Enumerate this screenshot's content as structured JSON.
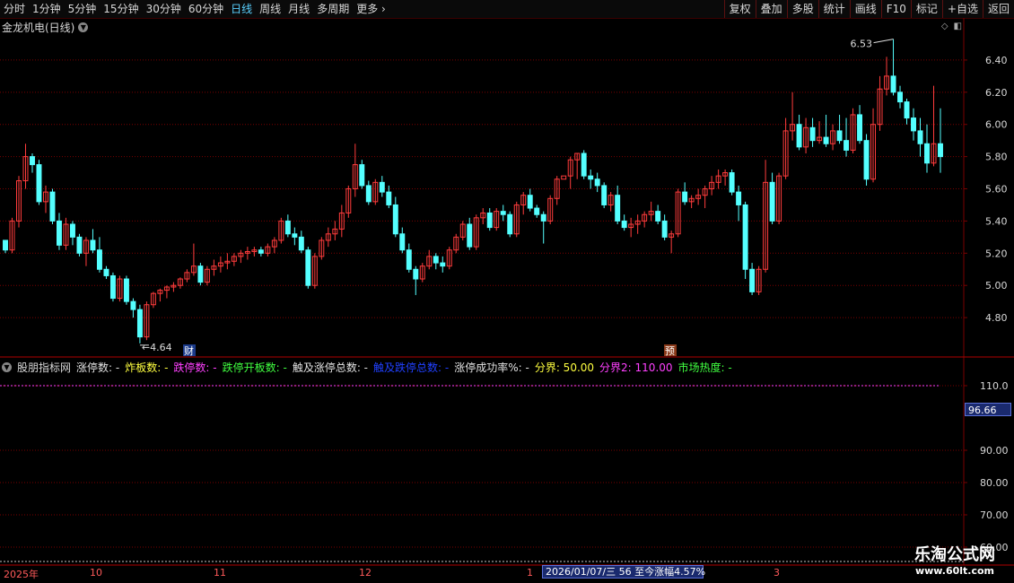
{
  "toolbar": {
    "periods": [
      "分时",
      "1分钟",
      "5分钟",
      "15分钟",
      "30分钟",
      "60分钟",
      "日线",
      "周线",
      "月线",
      "多周期",
      "更多"
    ],
    "active_period": "日线",
    "more_icon": "chevron-right-icon",
    "buttons": [
      "复权",
      "叠加",
      "多股",
      "统计",
      "画线",
      "F10",
      "标记",
      "+自选",
      "返回"
    ]
  },
  "chart": {
    "title": "金龙机电(日线)",
    "title_icon": "chevron-down-icon",
    "price_axis": [
      "6.40",
      "6.20",
      "6.00",
      "5.80",
      "5.60",
      "5.40",
      "5.20",
      "5.00",
      "4.80"
    ],
    "high_label": "6.53",
    "low_label": "4.64",
    "marker_cai": "财",
    "marker_yu": "预",
    "colors": {
      "up": "#ff3c3c",
      "down": "#54ffff",
      "grid": "#7a0000"
    }
  },
  "chart_data": {
    "type": "candlestick",
    "ohlc": [
      [
        5.28,
        5.28,
        5.2,
        5.22
      ],
      [
        5.22,
        5.42,
        5.2,
        5.4
      ],
      [
        5.4,
        5.68,
        5.36,
        5.65
      ],
      [
        5.65,
        5.88,
        5.6,
        5.8
      ],
      [
        5.8,
        5.82,
        5.7,
        5.75
      ],
      [
        5.75,
        5.78,
        5.5,
        5.52
      ],
      [
        5.52,
        5.62,
        5.45,
        5.58
      ],
      [
        5.58,
        5.6,
        5.38,
        5.4
      ],
      [
        5.4,
        5.45,
        5.22,
        5.25
      ],
      [
        5.25,
        5.42,
        5.22,
        5.38
      ],
      [
        5.38,
        5.4,
        5.25,
        5.3
      ],
      [
        5.3,
        5.32,
        5.18,
        5.2
      ],
      [
        5.2,
        5.3,
        5.12,
        5.28
      ],
      [
        5.28,
        5.35,
        5.2,
        5.22
      ],
      [
        5.22,
        5.3,
        5.08,
        5.1
      ],
      [
        5.1,
        5.12,
        5.04,
        5.06
      ],
      [
        5.06,
        5.08,
        4.9,
        4.92
      ],
      [
        4.92,
        5.06,
        4.9,
        5.04
      ],
      [
        5.04,
        5.06,
        4.88,
        4.9
      ],
      [
        4.9,
        4.92,
        4.8,
        4.85
      ],
      [
        4.85,
        4.88,
        4.64,
        4.68
      ],
      [
        4.68,
        4.9,
        4.66,
        4.88
      ],
      [
        4.88,
        4.96,
        4.86,
        4.95
      ],
      [
        4.95,
        4.98,
        4.9,
        4.97
      ],
      [
        4.97,
        5.0,
        4.92,
        4.99
      ],
      [
        4.99,
        5.02,
        4.96,
        5.0
      ],
      [
        5.0,
        5.05,
        4.98,
        5.04
      ],
      [
        5.04,
        5.1,
        5.02,
        5.08
      ],
      [
        5.08,
        5.26,
        5.06,
        5.12
      ],
      [
        5.12,
        5.14,
        5.0,
        5.02
      ],
      [
        5.02,
        5.12,
        5.0,
        5.1
      ],
      [
        5.1,
        5.16,
        5.06,
        5.12
      ],
      [
        5.12,
        5.18,
        5.08,
        5.14
      ],
      [
        5.14,
        5.2,
        5.1,
        5.15
      ],
      [
        5.15,
        5.2,
        5.12,
        5.18
      ],
      [
        5.18,
        5.22,
        5.14,
        5.2
      ],
      [
        5.2,
        5.24,
        5.16,
        5.21
      ],
      [
        5.21,
        5.24,
        5.18,
        5.22
      ],
      [
        5.22,
        5.24,
        5.18,
        5.2
      ],
      [
        5.2,
        5.26,
        5.18,
        5.24
      ],
      [
        5.24,
        5.3,
        5.2,
        5.28
      ],
      [
        5.28,
        5.42,
        5.26,
        5.4
      ],
      [
        5.4,
        5.44,
        5.3,
        5.32
      ],
      [
        5.32,
        5.36,
        5.25,
        5.3
      ],
      [
        5.3,
        5.34,
        5.2,
        5.22
      ],
      [
        5.22,
        5.24,
        4.98,
        5.0
      ],
      [
        5.0,
        5.2,
        4.98,
        5.18
      ],
      [
        5.18,
        5.3,
        5.16,
        5.28
      ],
      [
        5.28,
        5.36,
        5.24,
        5.32
      ],
      [
        5.32,
        5.4,
        5.28,
        5.35
      ],
      [
        5.35,
        5.5,
        5.3,
        5.45
      ],
      [
        5.45,
        5.62,
        5.42,
        5.6
      ],
      [
        5.6,
        5.88,
        5.55,
        5.75
      ],
      [
        5.75,
        5.78,
        5.6,
        5.62
      ],
      [
        5.62,
        5.65,
        5.5,
        5.52
      ],
      [
        5.52,
        5.66,
        5.5,
        5.64
      ],
      [
        5.64,
        5.68,
        5.55,
        5.58
      ],
      [
        5.58,
        5.62,
        5.48,
        5.5
      ],
      [
        5.5,
        5.55,
        5.3,
        5.32
      ],
      [
        5.32,
        5.36,
        5.2,
        5.22
      ],
      [
        5.22,
        5.26,
        5.08,
        5.1
      ],
      [
        5.1,
        5.12,
        4.94,
        5.04
      ],
      [
        5.04,
        5.14,
        5.02,
        5.12
      ],
      [
        5.12,
        5.22,
        5.1,
        5.18
      ],
      [
        5.18,
        5.2,
        5.1,
        5.14
      ],
      [
        5.14,
        5.18,
        5.08,
        5.12
      ],
      [
        5.12,
        5.24,
        5.1,
        5.22
      ],
      [
        5.22,
        5.32,
        5.2,
        5.3
      ],
      [
        5.3,
        5.4,
        5.28,
        5.38
      ],
      [
        5.38,
        5.42,
        5.22,
        5.24
      ],
      [
        5.24,
        5.44,
        5.22,
        5.42
      ],
      [
        5.42,
        5.48,
        5.38,
        5.45
      ],
      [
        5.45,
        5.48,
        5.34,
        5.36
      ],
      [
        5.36,
        5.48,
        5.34,
        5.46
      ],
      [
        5.46,
        5.5,
        5.4,
        5.44
      ],
      [
        5.44,
        5.46,
        5.3,
        5.32
      ],
      [
        5.32,
        5.52,
        5.3,
        5.5
      ],
      [
        5.5,
        5.58,
        5.44,
        5.56
      ],
      [
        5.56,
        5.6,
        5.46,
        5.48
      ],
      [
        5.48,
        5.5,
        5.42,
        5.44
      ],
      [
        5.44,
        5.46,
        5.26,
        5.4
      ],
      [
        5.4,
        5.56,
        5.38,
        5.54
      ],
      [
        5.54,
        5.68,
        5.5,
        5.66
      ],
      [
        5.66,
        5.7,
        5.7,
        5.68
      ],
      [
        5.68,
        5.8,
        5.6,
        5.78
      ],
      [
        5.78,
        5.82,
        5.66,
        5.82
      ],
      [
        5.82,
        5.84,
        5.66,
        5.68
      ],
      [
        5.68,
        5.72,
        5.6,
        5.66
      ],
      [
        5.66,
        5.7,
        5.58,
        5.62
      ],
      [
        5.62,
        5.64,
        5.48,
        5.5
      ],
      [
        5.5,
        5.58,
        5.46,
        5.56
      ],
      [
        5.56,
        5.62,
        5.38,
        5.4
      ],
      [
        5.4,
        5.44,
        5.34,
        5.36
      ],
      [
        5.36,
        5.42,
        5.3,
        5.38
      ],
      [
        5.38,
        5.44,
        5.32,
        5.4
      ],
      [
        5.4,
        5.46,
        5.36,
        5.44
      ],
      [
        5.44,
        5.52,
        5.4,
        5.46
      ],
      [
        5.46,
        5.5,
        5.38,
        5.4
      ],
      [
        5.4,
        5.44,
        5.28,
        5.3
      ],
      [
        5.3,
        5.34,
        5.2,
        5.32
      ],
      [
        5.32,
        5.6,
        5.3,
        5.58
      ],
      [
        5.58,
        5.64,
        5.5,
        5.52
      ],
      [
        5.52,
        5.56,
        5.48,
        5.54
      ],
      [
        5.54,
        5.6,
        5.5,
        5.56
      ],
      [
        5.56,
        5.62,
        5.48,
        5.6
      ],
      [
        5.6,
        5.68,
        5.56,
        5.64
      ],
      [
        5.64,
        5.72,
        5.6,
        5.68
      ],
      [
        5.68,
        5.72,
        5.62,
        5.7
      ],
      [
        5.7,
        5.72,
        5.56,
        5.58
      ],
      [
        5.58,
        5.62,
        5.4,
        5.5
      ],
      [
        5.5,
        5.52,
        5.04,
        5.1
      ],
      [
        5.1,
        5.14,
        4.94,
        4.96
      ],
      [
        4.96,
        5.12,
        4.94,
        5.1
      ],
      [
        5.1,
        5.78,
        5.08,
        5.64
      ],
      [
        5.64,
        5.7,
        5.38,
        5.4
      ],
      [
        5.4,
        5.7,
        5.38,
        5.68
      ],
      [
        5.68,
        6.04,
        5.66,
        5.96
      ],
      [
        5.96,
        6.2,
        5.9,
        6.0
      ],
      [
        6.0,
        6.06,
        5.84,
        5.86
      ],
      [
        5.86,
        6.04,
        5.82,
        5.98
      ],
      [
        5.98,
        6.04,
        5.86,
        5.9
      ],
      [
        5.9,
        6.02,
        5.88,
        5.92
      ],
      [
        5.92,
        6.06,
        5.86,
        5.88
      ],
      [
        5.88,
        6.0,
        5.84,
        5.96
      ],
      [
        5.96,
        6.06,
        5.88,
        5.9
      ],
      [
        5.9,
        6.04,
        5.8,
        5.84
      ],
      [
        5.84,
        6.1,
        5.82,
        6.06
      ],
      [
        6.06,
        6.12,
        5.88,
        5.9
      ],
      [
        5.9,
        5.94,
        5.62,
        5.66
      ],
      [
        5.66,
        6.1,
        5.64,
        6.0
      ],
      [
        6.0,
        6.3,
        5.96,
        6.22
      ],
      [
        6.22,
        6.42,
        6.18,
        6.3
      ],
      [
        6.3,
        6.53,
        6.18,
        6.2
      ],
      [
        6.2,
        6.24,
        6.1,
        6.14
      ],
      [
        6.14,
        6.16,
        6.0,
        6.04
      ],
      [
        6.04,
        6.1,
        5.9,
        5.96
      ],
      [
        5.96,
        6.04,
        5.8,
        5.88
      ],
      [
        5.88,
        6.0,
        5.7,
        5.76
      ],
      [
        5.76,
        6.24,
        5.74,
        5.88
      ],
      [
        5.88,
        6.1,
        5.7,
        5.8
      ]
    ],
    "ylim": [
      4.6,
      6.55
    ],
    "indicator": {
      "name": "股朋指标网",
      "items": [
        {
          "label": "涨停数: -",
          "color": "#e0e0e0"
        },
        {
          "label": "炸板数: -",
          "color": "#ffff40"
        },
        {
          "label": "跌停数: -",
          "color": "#ff40ff"
        },
        {
          "label": "跌停开板数: -",
          "color": "#40ff40"
        },
        {
          "label": "触及涨停总数: -",
          "color": "#e0e0e0"
        },
        {
          "label": "触及跌停总数: -",
          "color": "#2040ff"
        },
        {
          "label": "涨停成功率%: -",
          "color": "#e0e0e0"
        },
        {
          "label": "分界: 50.00",
          "color": "#ffff40"
        },
        {
          "label": "分界2: 110.00",
          "color": "#ff40ff"
        },
        {
          "label": "市场热度: -",
          "color": "#40ff40"
        }
      ],
      "axis": [
        "110.0",
        "90.00",
        "80.00",
        "70.00",
        "60.00"
      ],
      "current_value": "96.66",
      "ylim": [
        55,
        115
      ],
      "line_value": 110
    }
  },
  "timebar": {
    "labels": [
      "2025年",
      "10",
      "11",
      "12",
      "1",
      "3"
    ],
    "status": "2026/01/07/三 56 至今涨幅4.57%"
  },
  "watermark": {
    "line1": "乐淘公式网",
    "line2": "www.60lt.com"
  }
}
